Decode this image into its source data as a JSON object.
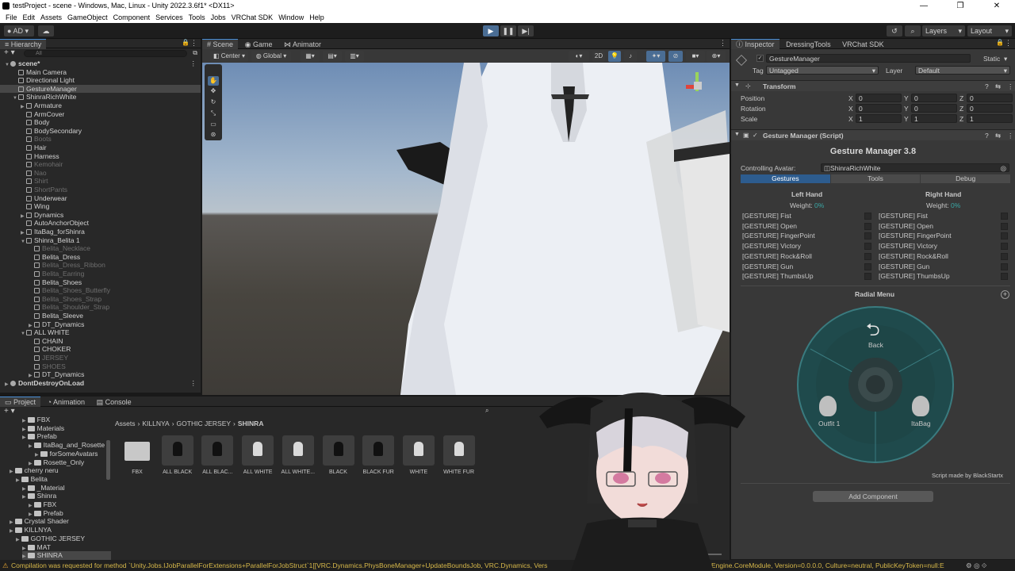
{
  "window": {
    "title": "testProject - scene - Windows, Mac, Linux - Unity 2022.3.6f1* <DX11>",
    "controls": [
      "—",
      "❐",
      "✕"
    ]
  },
  "menu": [
    "File",
    "Edit",
    "Assets",
    "GameObject",
    "Component",
    "Services",
    "Tools",
    "Jobs",
    "VRChat SDK",
    "Window",
    "Help"
  ],
  "toolbar": {
    "account": "AD",
    "layers": "Layers",
    "layout": "Layout"
  },
  "hierarchy": {
    "title": "Hierarchy",
    "search_placeholder": "All",
    "items": [
      {
        "label": "scene*",
        "indent": 0,
        "arrow": "▼",
        "dim": false,
        "sel": false,
        "unity": true
      },
      {
        "label": "Main Camera",
        "indent": 1,
        "arrow": "",
        "dim": false,
        "sel": false
      },
      {
        "label": "Directional Light",
        "indent": 1,
        "arrow": "",
        "dim": false,
        "sel": false
      },
      {
        "label": "GestureManager",
        "indent": 1,
        "arrow": "",
        "dim": false,
        "sel": true
      },
      {
        "label": "ShinraRichWhite",
        "indent": 1,
        "arrow": "▼",
        "dim": false,
        "sel": false
      },
      {
        "label": "Armature",
        "indent": 2,
        "arrow": "▶",
        "dim": false,
        "sel": false
      },
      {
        "label": "ArmCover",
        "indent": 2,
        "arrow": "",
        "dim": false,
        "sel": false
      },
      {
        "label": "Body",
        "indent": 2,
        "arrow": "",
        "dim": false,
        "sel": false
      },
      {
        "label": "BodySecondary",
        "indent": 2,
        "arrow": "",
        "dim": false,
        "sel": false
      },
      {
        "label": "Boots",
        "indent": 2,
        "arrow": "",
        "dim": true,
        "sel": false
      },
      {
        "label": "Hair",
        "indent": 2,
        "arrow": "",
        "dim": false,
        "sel": false
      },
      {
        "label": "Harness",
        "indent": 2,
        "arrow": "",
        "dim": false,
        "sel": false
      },
      {
        "label": "Kemohair",
        "indent": 2,
        "arrow": "",
        "dim": true,
        "sel": false
      },
      {
        "label": "Nao",
        "indent": 2,
        "arrow": "",
        "dim": true,
        "sel": false
      },
      {
        "label": "Shirt",
        "indent": 2,
        "arrow": "",
        "dim": true,
        "sel": false
      },
      {
        "label": "ShortPants",
        "indent": 2,
        "arrow": "",
        "dim": true,
        "sel": false
      },
      {
        "label": "Underwear",
        "indent": 2,
        "arrow": "",
        "dim": false,
        "sel": false
      },
      {
        "label": "Wing",
        "indent": 2,
        "arrow": "",
        "dim": false,
        "sel": false
      },
      {
        "label": "Dynamics",
        "indent": 2,
        "arrow": "▶",
        "dim": false,
        "sel": false
      },
      {
        "label": "AutoAnchorObject",
        "indent": 2,
        "arrow": "",
        "dim": false,
        "sel": false
      },
      {
        "label": "ItaBag_forShinra",
        "indent": 2,
        "arrow": "▶",
        "dim": false,
        "sel": false
      },
      {
        "label": "Shinra_Belita 1",
        "indent": 2,
        "arrow": "▼",
        "dim": false,
        "sel": false
      },
      {
        "label": "Belita_Necklace",
        "indent": 3,
        "arrow": "",
        "dim": true,
        "sel": false
      },
      {
        "label": "Belita_Dress",
        "indent": 3,
        "arrow": "",
        "dim": false,
        "sel": false
      },
      {
        "label": "Belita_Dress_Ribbon",
        "indent": 3,
        "arrow": "",
        "dim": true,
        "sel": false
      },
      {
        "label": "Belita_Earring",
        "indent": 3,
        "arrow": "",
        "dim": true,
        "sel": false
      },
      {
        "label": "Belita_Shoes",
        "indent": 3,
        "arrow": "",
        "dim": false,
        "sel": false
      },
      {
        "label": "Belita_Shoes_Butterfly",
        "indent": 3,
        "arrow": "",
        "dim": true,
        "sel": false
      },
      {
        "label": "Belita_Shoes_Strap",
        "indent": 3,
        "arrow": "",
        "dim": true,
        "sel": false
      },
      {
        "label": "Belita_Shoulder_Strap",
        "indent": 3,
        "arrow": "",
        "dim": true,
        "sel": false
      },
      {
        "label": "Belita_Sleeve",
        "indent": 3,
        "arrow": "",
        "dim": false,
        "sel": false
      },
      {
        "label": "DT_Dynamics",
        "indent": 3,
        "arrow": "▶",
        "dim": false,
        "sel": false
      },
      {
        "label": "ALL WHITE",
        "indent": 2,
        "arrow": "▼",
        "dim": false,
        "sel": false
      },
      {
        "label": "CHAIN",
        "indent": 3,
        "arrow": "",
        "dim": false,
        "sel": false
      },
      {
        "label": "CHOKER",
        "indent": 3,
        "arrow": "",
        "dim": false,
        "sel": false
      },
      {
        "label": "JERSEY",
        "indent": 3,
        "arrow": "",
        "dim": true,
        "sel": false
      },
      {
        "label": "SHOES",
        "indent": 3,
        "arrow": "",
        "dim": true,
        "sel": false
      },
      {
        "label": "DT_Dynamics",
        "indent": 3,
        "arrow": "▶",
        "dim": false,
        "sel": false
      },
      {
        "label": "DontDestroyOnLoad",
        "indent": 0,
        "arrow": "▶",
        "dim": false,
        "sel": false,
        "unity": true
      }
    ]
  },
  "scene": {
    "tabs": [
      "Scene",
      "Game",
      "Animator"
    ],
    "pivot": "Center",
    "space": "Global",
    "mode_2d": "2D"
  },
  "inspector": {
    "tabs": [
      "Inspector",
      "DressingTools",
      "VRChat SDK"
    ],
    "object_name": "GestureManager",
    "static_label": "Static",
    "tag_label": "Tag",
    "tag_value": "Untagged",
    "layer_label": "Layer",
    "layer_value": "Default",
    "transform": {
      "title": "Transform",
      "rows": [
        {
          "label": "Position",
          "x": "0",
          "y": "0",
          "z": "0"
        },
        {
          "label": "Rotation",
          "x": "0",
          "y": "0",
          "z": "0"
        },
        {
          "label": "Scale",
          "x": "1",
          "y": "1",
          "z": "1"
        }
      ],
      "axis": [
        "X",
        "Y",
        "Z"
      ]
    },
    "component_title": "Gesture Manager (Script)",
    "gm_title": "Gesture Manager 3.8",
    "controlling_label": "Controlling Avatar:",
    "controlling_value": "ShinraRichWhite",
    "gm_tabs": [
      "Gestures",
      "Tools",
      "Debug"
    ],
    "left_hand": "Left Hand",
    "right_hand": "Right Hand",
    "weight_label": "Weight:",
    "weight_value": "0%",
    "gestures": [
      "[GESTURE] Fist",
      "[GESTURE] Open",
      "[GESTURE] FingerPoint",
      "[GESTURE] Victory",
      "[GESTURE] Rock&Roll",
      "[GESTURE] Gun",
      "[GESTURE] ThumbsUp"
    ],
    "radial_title": "Radial Menu",
    "radial_back": "Back",
    "radial_left": "Outfit 1",
    "radial_right": "ItaBag",
    "credit": "Script made by BlackStartx",
    "add_component": "Add Component"
  },
  "project": {
    "tabs": [
      "Project",
      "Animation",
      "Console"
    ],
    "breadcrumb": [
      "Assets",
      "KILLNYA",
      "GOTHIC JERSEY",
      "SHINRA"
    ],
    "tree": [
      {
        "label": "FBX",
        "indent": 3
      },
      {
        "label": "Materials",
        "indent": 3
      },
      {
        "label": "Prefab",
        "indent": 3
      },
      {
        "label": "ItaBag_and_Rosette",
        "indent": 4
      },
      {
        "label": "forSomeAvatars",
        "indent": 5
      },
      {
        "label": "Rosette_Only",
        "indent": 4
      },
      {
        "label": "cherry neru",
        "indent": 1
      },
      {
        "label": "Belita",
        "indent": 2
      },
      {
        "label": "_Material",
        "indent": 3
      },
      {
        "label": "Shinra",
        "indent": 3
      },
      {
        "label": "FBX",
        "indent": 4
      },
      {
        "label": "Prefab",
        "indent": 4
      },
      {
        "label": "Crystal Shader",
        "indent": 1
      },
      {
        "label": "KILLNYA",
        "indent": 1
      },
      {
        "label": "GOTHIC JERSEY",
        "indent": 2
      },
      {
        "label": "MAT",
        "indent": 3
      },
      {
        "label": "SHINRA",
        "indent": 3
      }
    ],
    "assets": [
      "FBX",
      "ALL BLACK",
      "ALL BLAC...",
      "ALL WHITE",
      "ALL WHITE...",
      "BLACK",
      "BLACK FUR",
      "WHITE",
      "WHITE FUR"
    ]
  },
  "status": {
    "text": "Compilation was requested for method `Unity.Jobs.IJobParallelForExtensions+ParallelForJobStruct`1[[VRC.Dynamics.PhysBoneManager+UpdateBoundsJob, VRC.Dynamics, Versio",
    "text_right": "Engine.CoreModule, Version=0.0.0.0, Culture=neutral, PublicKeyToken=null:E"
  },
  "colors": {
    "accent": "#4a90d9",
    "radial": "#1f4a4c",
    "warning": "#d7b84a"
  }
}
